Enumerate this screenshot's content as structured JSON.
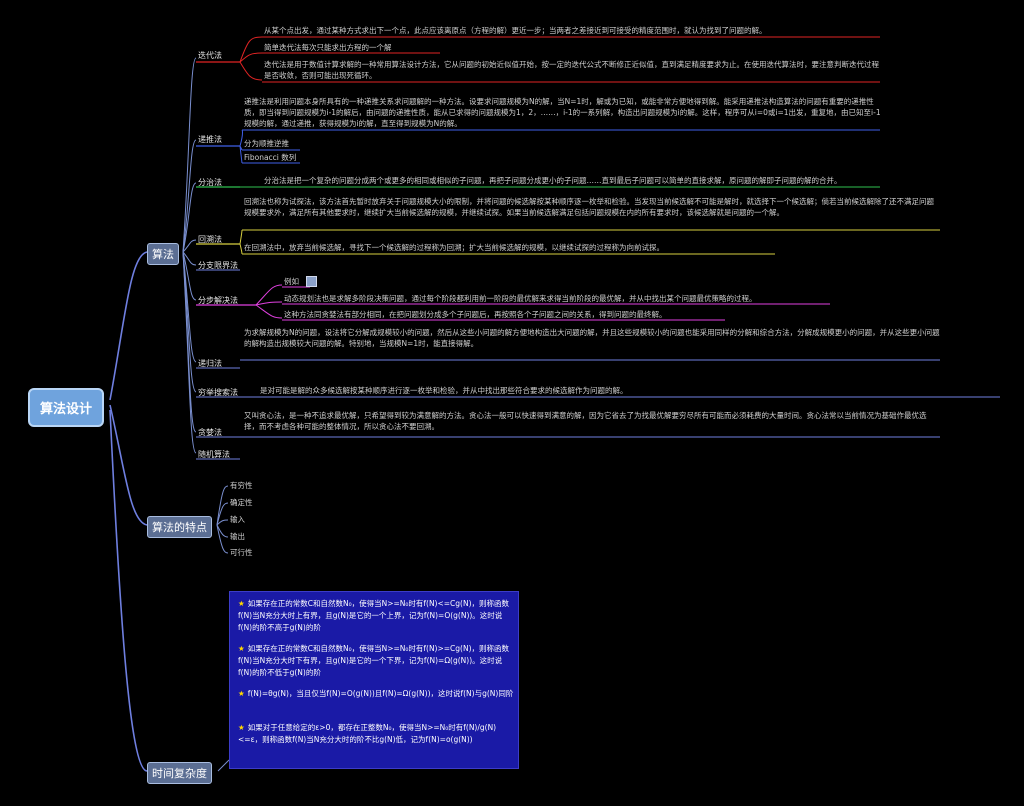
{
  "root": "算法设计",
  "branches": {
    "algorithm": "算法",
    "features": "算法的特点",
    "complexity": "时间复杂度"
  },
  "methods": {
    "iteration": {
      "label": "迭代法",
      "p1": "从某个点出发，通过某种方式求出下一个点，此点应该离原点（方程的解）更近一步；当两者之差接近到可接受的精度范围时，就认为找到了问题的解。",
      "p2": "简单迭代法每次只能求出方程的一个解",
      "p3": "迭代法是用于数值计算求解的一种常用算法设计方法，它从问题的初始近似值开始，按一定的迭代公式不断修正近似值，直到满足精度要求为止。在使用迭代算法时，要注意判断迭代过程是否收敛，否则可能出现死循环。"
    },
    "recursion": {
      "label": "递推法",
      "p1": "递推法是利用问题本身所具有的一种递推关系求问题解的一种方法。设要求问题规模为N的解，当N=1时，解或为已知，或能非常方便地得到解。能采用递推法构造算法的问题有重要的递推性质，即当得到问题规模为i-1的解后，由问题的递推性质，能从已求得的问题规模为1，2，……，i-1的一系列解，构造出问题规模为i的解。这样，程序可从i=0或i=1出发，重复地，由已知至i-1规模的解，通过递推，获得规模为i的解，直至得到规模为N的解。",
      "c1": "分为顺推逆推",
      "c2": "Fibonacci 数列"
    },
    "divide": {
      "label": "分治法",
      "p1": "分治法是把一个复杂的问题分成两个或更多的相同或相似的子问题，再把子问题分成更小的子问题……直到最后子问题可以简单的直接求解，原问题的解即子问题的解的合并。"
    },
    "backtrack": {
      "label": "回溯法",
      "p1": "回溯法也称为试探法，该方法首先暂时放弃关于问题规模大小的限制，并将问题的候选解按某种顺序逐一枚举和检验。当发现当前候选解不可能是解时，就选择下一个候选解；倘若当前候选解除了还不满足问题规模要求外，满足所有其他要求时，继续扩大当前候选解的规模，并继续试探。如果当前候选解满足包括问题规模在内的所有要求时，该候选解就是问题的一个解。",
      "p2": "在回溯法中，放弃当前候选解，寻找下一个候选解的过程称为回溯；扩大当前候选解的规模，以继续试探的过程称为向前试探。"
    },
    "branch": {
      "label": "分支限界法"
    },
    "dp": {
      "label": "分步解决法",
      "c1": "例如",
      "c2": "动态规划法也是求解多阶段决策问题，通过每个阶段都利用前一阶段的最优解来求得当前阶段的最优解，并从中找出某个问题最优策略的过程。",
      "c3": "这种方法同贪婪法有部分相同，在把问题划分成多个子问题后，再按照各个子问题之间的关系，得到问题的最终解。"
    },
    "recursive": {
      "label": "递归法",
      "p1": "为求解规模为N的问题，设法将它分解成规模较小的问题，然后从这些小问题的解方便地构造出大问题的解，并且这些规模较小的问题也能采用同样的分解和综合方法，分解成规模更小的问题，并从这些更小问题的解构造出规模较大问题的解。特别地，当规模N=1时，能直接得解。"
    },
    "exhaustive": {
      "label": "穷举搜索法",
      "p1": "是对可能是解的众多候选解按某种顺序进行逐一枚举和检验，并从中找出那些符合要求的候选解作为问题的解。"
    },
    "greedy": {
      "label": "贪婪法",
      "p1": "又叫贪心法，是一种不追求最优解，只希望得到较为满意解的方法。贪心法一般可以快速得到满意的解，因为它省去了为找最优解要穷尽所有可能而必须耗费的大量时间。贪心法常以当前情况为基础作最优选择，而不考虑各种可能的整体情况，所以贪心法不要回溯。"
    },
    "random": {
      "label": "随机算法"
    }
  },
  "featureItems": [
    "有穷性",
    "确定性",
    "输入",
    "输出",
    "可行性"
  ],
  "complexityItems": [
    "如果存在正的常数C和自然数N₀，使得当N>=N₀时有f(N)<=Cg(N)，则称函数f(N)当N充分大时上有界，且g(N)是它的一个上界，记为f(N)=O(g(N))。这时说f(N)的阶不高于g(N)的阶",
    "如果存在正的常数C和自然数N₀，使得当N>=N₀时有f(N)>=Cg(N)，则称函数f(N)当N充分大时下有界，且g(N)是它的一个下界，记为f(N)=Ω(g(N))。这时说f(N)的阶不低于g(N)的阶",
    "f(N)=θg(N)，当且仅当f(N)=O(g(N))且f(N)=Ω(g(N))，这时说f(N)与g(N)同阶",
    "如果对于任意给定的ε>0，都存在正整数N₀，使得当N>=N₀时有f(N)/g(N)<=ε，则称函数f(N)当N充分大时的阶不比g(N)低，记为f(N)=o(g(N))"
  ],
  "colors": {
    "background": "#000000",
    "branchLine": "#6f7fe0",
    "rootFill": "#6fa3dd",
    "boxFill": "#5b6e93",
    "blueBox": "#1a1aa6",
    "red": "#e02424",
    "pink": "#e040e0",
    "green": "#2fbf4f",
    "yellow": "#d8d040",
    "blue": "#3f5fe8"
  }
}
